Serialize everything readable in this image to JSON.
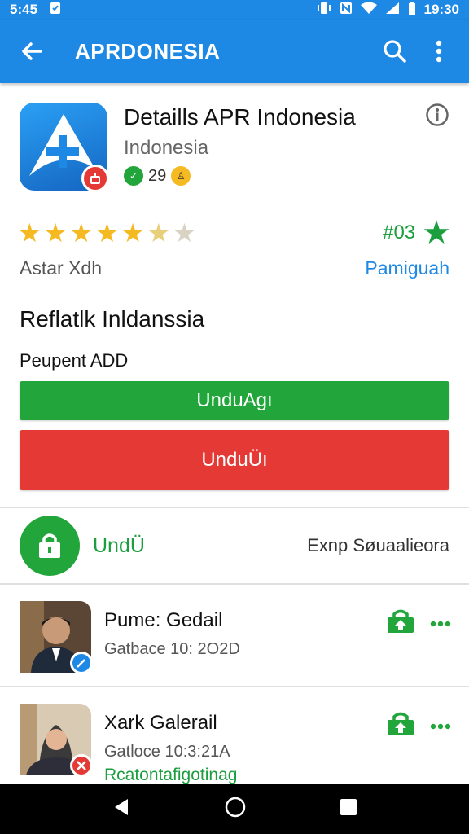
{
  "status_bar": {
    "time": "5:45",
    "right_time": "19:30"
  },
  "app_bar": {
    "title": "APRDONESIA"
  },
  "app": {
    "title": "Detaills APR Indonesia",
    "subtitle": "Indonesia",
    "meta_value": "29"
  },
  "rating": {
    "stars": 5.5,
    "max_stars": 7,
    "count_label": "#03",
    "left_caption": "Astar Xdh",
    "right_link": "Pamigu͏ah"
  },
  "section": {
    "title": "Reflatlk Inldanssia",
    "label": "Peupent ADD"
  },
  "buttons": {
    "green": "UnduAgı",
    "red": "UnduÜı"
  },
  "download": {
    "label": "UndÜ",
    "right": "Exnp Søuaalieora"
  },
  "list": [
    {
      "title": "Pume: Gedail",
      "subtitle": "Gatbace 10: 2O2D",
      "extra": ""
    },
    {
      "title": "Xark Galerail",
      "subtitle": "Gatloce 10:3:21A",
      "extra": "Rcatontafigotinag"
    }
  ],
  "colors": {
    "primary": "#1e88e5",
    "green": "#22a53b",
    "red": "#e53935",
    "star": "#f5b921"
  }
}
